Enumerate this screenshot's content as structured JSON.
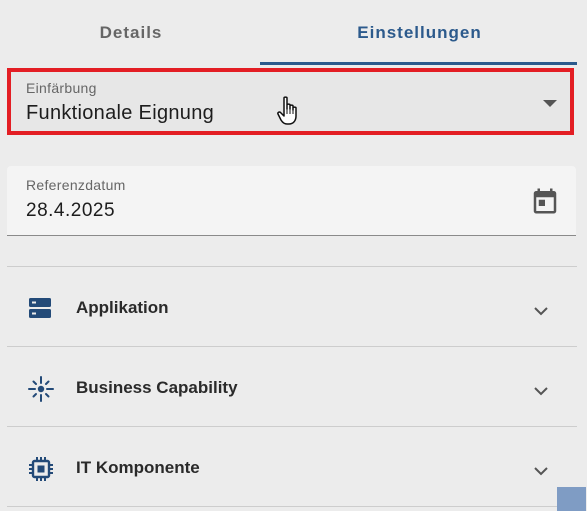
{
  "tabs": [
    {
      "label": "Details",
      "active": false
    },
    {
      "label": "Einstellungen",
      "active": true
    }
  ],
  "coloring": {
    "label": "Einfärbung",
    "value": "Funktionale Eignung"
  },
  "reference_date": {
    "label": "Referenzdatum",
    "value": "28.4.2025"
  },
  "categories": [
    {
      "label": "Applikation",
      "icon": "server-icon"
    },
    {
      "label": "Business Capability",
      "icon": "capability-icon"
    },
    {
      "label": "IT Komponente",
      "icon": "chip-icon"
    }
  ],
  "colors": {
    "accent": "#2c5a8c",
    "highlight": "#e31e24",
    "icon": "#234a78"
  }
}
